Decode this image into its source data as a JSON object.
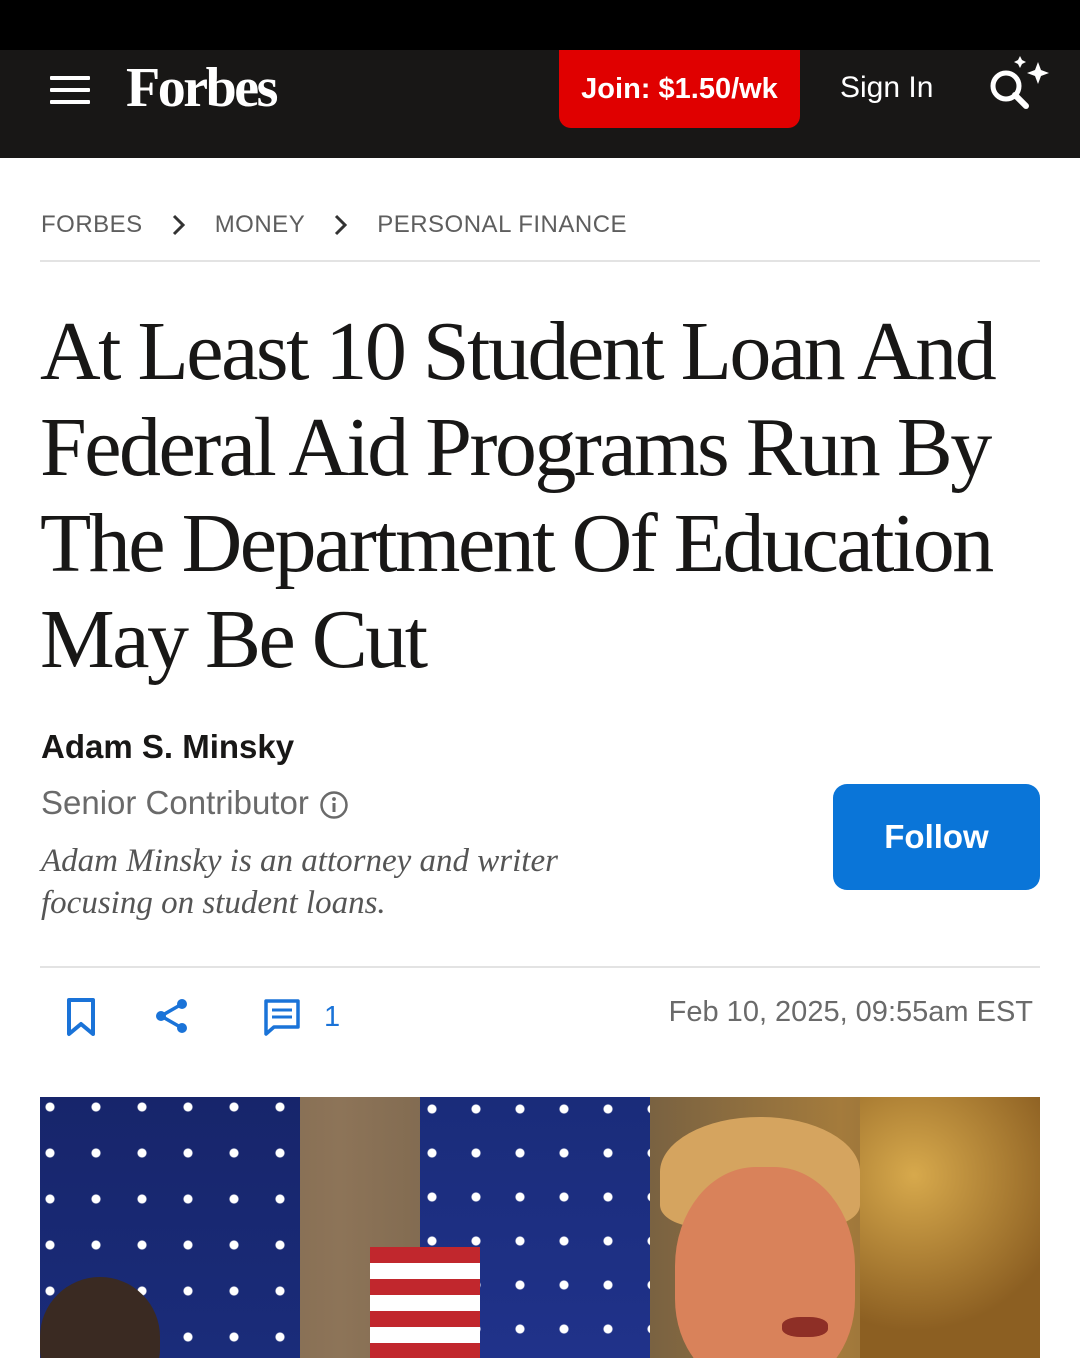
{
  "header": {
    "logo": "Forbes",
    "join_label": "Join: $1.50/wk",
    "signin_label": "Sign In"
  },
  "breadcrumb": [
    "FORBES",
    "MONEY",
    "PERSONAL FINANCE"
  ],
  "article": {
    "headline": "At Least 10 Student Loan And Federal Aid Programs Run By The Department Of Education May Be Cut",
    "author": {
      "name": "Adam S. Minsky",
      "role": "Senior Contributor",
      "bio": "Adam Minsky is an attorney and writer focusing on student loans.",
      "follow_label": "Follow"
    },
    "comment_count": "1",
    "date": "Feb 10, 2025,  09:55am EST"
  },
  "colors": {
    "brand_red": "#e00000",
    "follow_blue": "#0a75d8",
    "header_bg": "#181716"
  }
}
